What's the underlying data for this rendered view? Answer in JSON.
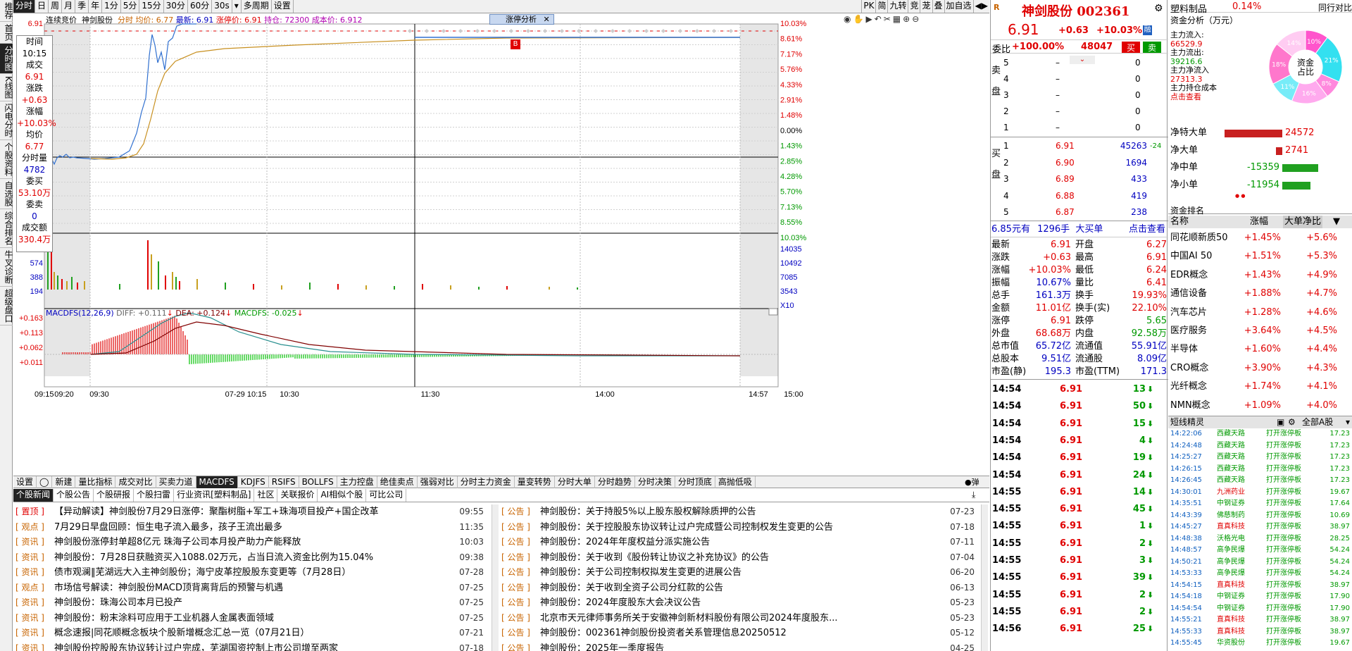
{
  "left_nav": [
    "推荐",
    "首页",
    "分时图",
    "K线图",
    "闪电分时",
    "个股资料",
    "自选股",
    "综合排名",
    "牛叉诊断",
    "超级盘口"
  ],
  "top_tabs": [
    "分时",
    "日",
    "周",
    "月",
    "季",
    "年",
    "1分",
    "5分",
    "15分",
    "30分",
    "60分",
    "30s",
    "▾",
    "多周期",
    "设置"
  ],
  "top_right": [
    "PK",
    "简",
    "九转",
    "竞",
    "茏",
    "叠",
    "加自选",
    "◀▶"
  ],
  "chart_header": {
    "mode": "连续竞价",
    "name": "神剑股份",
    "time_label": "分时",
    "avg": "均价: 6.77",
    "last": "最新: 6.91",
    "limit": "涨停价: 6.91",
    "hold": "持仓: 72300",
    "cost": "成本价: 6.912",
    "analysis_tab": "涨停分析"
  },
  "price_axis_left": [
    "6.91",
    "5.74",
    "5.65"
  ],
  "price_axis_right": [
    "10.03%",
    "8.61%",
    "7.17%",
    "5.76%",
    "4.33%",
    "2.91%",
    "1.48%",
    "0.00%",
    "1.43%",
    "2.85%",
    "4.28%",
    "5.70%",
    "7.13%",
    "8.55%",
    "10.03%"
  ],
  "volume_axis_left": [
    "768",
    "574",
    "388",
    "194"
  ],
  "volume_axis_right": [
    "14035",
    "10492",
    "7085",
    "3543",
    "X10"
  ],
  "macd_label": {
    "title": "MACDFS(12,26,9)",
    "diff": "DIFF: +0.111",
    "dea": "DEA: +0.124",
    "macd": "MACDFS: -0.025"
  },
  "macd_axis_left": [
    "+0.163",
    "+0.113",
    "+0.062",
    "+0.011"
  ],
  "time_axis": [
    "09:15",
    "09:20",
    "09:30",
    "07-29 10:15",
    "10:30",
    "11:30",
    "14:00",
    "14:57",
    "15:00"
  ],
  "marker_b": "B",
  "cross_info": [
    [
      "时间",
      "10:15"
    ],
    [
      "成交",
      "6.91"
    ],
    [
      "涨跌",
      "+0.63"
    ],
    [
      "涨幅",
      "+10.03%"
    ],
    [
      "均价",
      "6.77"
    ],
    [
      "分时量",
      "4782"
    ],
    [
      "委买",
      "53.10万"
    ],
    [
      "委卖",
      "0"
    ],
    [
      "成交额",
      "330.4万"
    ]
  ],
  "indicator_tabs": [
    "设置",
    "◯",
    "新建",
    "量比指标",
    "成交对比",
    "买卖力道",
    "MACDFS",
    "KDJFS",
    "RSIFS",
    "BOLLFS",
    "主力控盘",
    "绝佳卖点",
    "强弱对比",
    "分时主力资金",
    "量变转势",
    "分时大单",
    "分时趋势",
    "分时决策",
    "分时顶底",
    "高抛低吸"
  ],
  "indicator_active": "MACDFS",
  "news_tabs": [
    "个股新闻",
    "个股公告",
    "个股研报",
    "个股扫雷",
    "行业资讯[塑料制品]",
    "社区",
    "关联报价",
    "AI相似个股",
    "可比公司"
  ],
  "news_left": [
    [
      "置顶",
      "【异动解读】神剑股份7月29日涨停：聚酯树脂+军工+珠海项目投产+国企改革",
      "09:55"
    ],
    [
      "观点",
      "7月29日早盘回顾：恒生电子流入最多，孩子王流出最多",
      "11:35"
    ],
    [
      "资讯",
      "神剑股份涨停封单超8亿元 珠海子公司本月投产助力产能释放",
      "10:03"
    ],
    [
      "资讯",
      "神剑股份：7月28日获融资买入1088.02万元，占当日流入资金比例为15.04%",
      "09:38"
    ],
    [
      "资讯",
      "债市观澜‖芜湖远大入主神剑股份；海宁皮革控股股东变更等（7月28日）",
      "07-28"
    ],
    [
      "观点",
      "市场信号解读：神剑股份MACD顶背离背后的预警与机遇",
      "07-25"
    ],
    [
      "资讯",
      "神剑股份：珠海公司本月已投产",
      "07-25"
    ],
    [
      "资讯",
      "神剑股份：粉末涂料可应用于工业机器人金属表面领域",
      "07-25"
    ],
    [
      "资讯",
      "概念速报|同花顺概念板块个股新增概念汇总一览（07月21日）",
      "07-21"
    ],
    [
      "资讯",
      "神剑股份控股股东协议转让过户完成，芜湖国资控制上市公司增至两家",
      "07-18"
    ]
  ],
  "news_right": [
    [
      "公告",
      "神剑股份：关于持股5%以上股东股权解除质押的公告",
      "07-23"
    ],
    [
      "公告",
      "神剑股份：关于控股股东协议转让过户完成暨公司控制权发生变更的公告",
      "07-18"
    ],
    [
      "公告",
      "神剑股份：2024年年度权益分派实施公告",
      "07-11"
    ],
    [
      "公告",
      "神剑股份：关于收到《股份转让协议之补充协议》的公告",
      "07-04"
    ],
    [
      "公告",
      "神剑股份：关于公司控制权拟发生变更的进展公告",
      "06-20"
    ],
    [
      "公告",
      "神剑股份：关于收到全资子公司分红款的公告",
      "06-13"
    ],
    [
      "公告",
      "神剑股份：2024年度股东大会决议公告",
      "05-23"
    ],
    [
      "公告",
      "北京市天元律师事务所关于安徽神剑新材料股份有限公司2024年度股东...",
      "05-23"
    ],
    [
      "公告",
      "神剑股份：002361神剑股份投资者关系管理信息20250512",
      "05-12"
    ],
    [
      "公告",
      "神剑股份：2025年一季度报告",
      "04-25"
    ]
  ],
  "quote": {
    "title": "神剑股份 002361",
    "price": "6.91",
    "change": "+0.63",
    "pct": "+10.03%",
    "rong": "融",
    "weibi_label": "委比",
    "weibi": "+100.00%",
    "weicha": "48047",
    "buy_btn": "买",
    "sell_btn": "卖",
    "sell_label": "卖盘",
    "buy_label": "买盘",
    "sells": [
      [
        "5",
        "–",
        "0"
      ],
      [
        "4",
        "–",
        "0"
      ],
      [
        "3",
        "–",
        "0"
      ],
      [
        "2",
        "–",
        "0"
      ],
      [
        "1",
        "–",
        "0"
      ]
    ],
    "buys": [
      [
        "1",
        "6.91",
        "45263",
        "-24"
      ],
      [
        "2",
        "6.90",
        "1694",
        ""
      ],
      [
        "3",
        "6.89",
        "433",
        ""
      ],
      [
        "4",
        "6.88",
        "419",
        ""
      ],
      [
        "5",
        "6.87",
        "238",
        ""
      ]
    ],
    "big_line": {
      "price": "6.85元有",
      "qty": "1296手",
      "type": "大买单",
      "link": "点击查看"
    },
    "stats": [
      [
        "最新",
        "6.91",
        "开盘",
        "6.27"
      ],
      [
        "涨跌",
        "+0.63",
        "最高",
        "6.91"
      ],
      [
        "涨幅",
        "+10.03%",
        "最低",
        "6.24"
      ],
      [
        "振幅",
        "10.67%",
        "量比",
        "6.41"
      ],
      [
        "总手",
        "161.3万",
        "换手",
        "19.93%"
      ],
      [
        "金额",
        "11.01亿",
        "换手(实)",
        "22.10%"
      ],
      [
        "涨停",
        "6.91",
        "跌停",
        "5.65"
      ],
      [
        "外盘",
        "68.68万",
        "内盘",
        "92.58万"
      ],
      [
        "总市值",
        "65.72亿",
        "流通值",
        "55.91亿"
      ],
      [
        "总股本",
        "9.51亿",
        "流通股",
        "8.09亿"
      ],
      [
        "市盈(静)",
        "195.3",
        "市盈(TTM)",
        "171.3"
      ]
    ],
    "ticks": [
      [
        "14:54",
        "6.91",
        "13"
      ],
      [
        "14:54",
        "6.91",
        "50"
      ],
      [
        "14:54",
        "6.91",
        "15"
      ],
      [
        "14:54",
        "6.91",
        "4"
      ],
      [
        "14:54",
        "6.91",
        "19"
      ],
      [
        "14:54",
        "6.91",
        "24"
      ],
      [
        "14:55",
        "6.91",
        "14"
      ],
      [
        "14:55",
        "6.91",
        "45"
      ],
      [
        "14:55",
        "6.91",
        "1"
      ],
      [
        "14:55",
        "6.91",
        "2"
      ],
      [
        "14:55",
        "6.91",
        "3"
      ],
      [
        "14:55",
        "6.91",
        "39"
      ],
      [
        "14:55",
        "6.91",
        "2"
      ],
      [
        "14:55",
        "6.91",
        "2"
      ],
      [
        "14:56",
        "6.91",
        "25"
      ]
    ]
  },
  "right": {
    "industry": "塑料制品",
    "industry_pct": "0.14%",
    "industry_btn": "同行对比",
    "fund_title": "资金分析（万元）",
    "fund_lines": [
      [
        "主力流入:",
        "66529.9"
      ],
      [
        "主力流出:",
        "39216.6"
      ],
      [
        "主力净流入",
        "27313.3"
      ],
      [
        "主力持仓成本",
        ""
      ],
      [
        "点击查看",
        ""
      ]
    ],
    "donut_center": "资金\n占比",
    "donut_pcts": [
      "10%",
      "21%",
      "8%",
      "16%",
      "11%",
      "18%",
      "14%"
    ],
    "net": [
      [
        "净特大单",
        "24572"
      ],
      [
        "净大单",
        "2741"
      ],
      [
        "净中单",
        "-15359"
      ],
      [
        "净小单",
        "-11954"
      ]
    ],
    "net_values": [
      24572,
      2741,
      -15359,
      -11954
    ],
    "rank_title": "资金排名",
    "rank_head": [
      "名称",
      "涨幅",
      "大单净比"
    ],
    "rank": [
      [
        "同花顺新质50",
        "+1.45%",
        "+5.6%"
      ],
      [
        "中国AI 50",
        "+1.51%",
        "+5.3%"
      ],
      [
        "EDR概念",
        "+1.43%",
        "+4.9%"
      ],
      [
        "通信设备",
        "+1.88%",
        "+4.7%"
      ],
      [
        "汽车芯片",
        "+1.28%",
        "+4.6%"
      ],
      [
        "医疗服务",
        "+3.64%",
        "+4.5%"
      ],
      [
        "半导体",
        "+1.60%",
        "+4.4%"
      ],
      [
        "CRO概念",
        "+3.90%",
        "+4.3%"
      ],
      [
        "光纤概念",
        "+1.74%",
        "+4.1%"
      ],
      [
        "NMN概念",
        "+1.09%",
        "+4.0%"
      ]
    ],
    "short_title": "短线精灵",
    "short_all": "全部A股",
    "short": [
      [
        "14:22:06",
        "西藏天路",
        "打开涨停板",
        "17.23"
      ],
      [
        "14:24:48",
        "西藏天路",
        "打开涨停板",
        "17.23"
      ],
      [
        "14:25:27",
        "西藏天路",
        "打开涨停板",
        "17.23"
      ],
      [
        "14:26:15",
        "西藏天路",
        "打开涨停板",
        "17.23"
      ],
      [
        "14:26:45",
        "西藏天路",
        "打开涨停板",
        "17.23"
      ],
      [
        "14:30:01",
        "九洲药业",
        "打开涨停板",
        "19.67"
      ],
      [
        "14:35:51",
        "中钢证券",
        "打开涨停板",
        "17.64"
      ],
      [
        "14:43:39",
        "佛慈制药",
        "打开涨停板",
        "10.69"
      ],
      [
        "14:45:27",
        "直真科技",
        "打开涨停板",
        "38.97"
      ],
      [
        "14:48:38",
        "沃格光电",
        "打开涨停板",
        "28.25"
      ],
      [
        "14:48:57",
        "高争民爆",
        "打开涨停板",
        "54.24"
      ],
      [
        "14:50:21",
        "高争民爆",
        "打开涨停板",
        "54.24"
      ],
      [
        "14:53:33",
        "高争民爆",
        "打开涨停板",
        "54.24"
      ],
      [
        "14:54:15",
        "直真科技",
        "打开涨停板",
        "38.97"
      ],
      [
        "14:54:18",
        "中钢证券",
        "打开涨停板",
        "17.90"
      ],
      [
        "14:54:54",
        "中钢证券",
        "打开涨停板",
        "17.90"
      ],
      [
        "14:55:21",
        "直真科技",
        "打开涨停板",
        "38.97"
      ],
      [
        "14:55:33",
        "直真科技",
        "打开涨停板",
        "38.97"
      ],
      [
        "14:55:45",
        "华资股份",
        "打开涨停板",
        "19.67"
      ]
    ]
  },
  "colors": {
    "red": "#e00000",
    "green": "#009900",
    "blue": "#0000c0",
    "active_bg": "#222222"
  }
}
